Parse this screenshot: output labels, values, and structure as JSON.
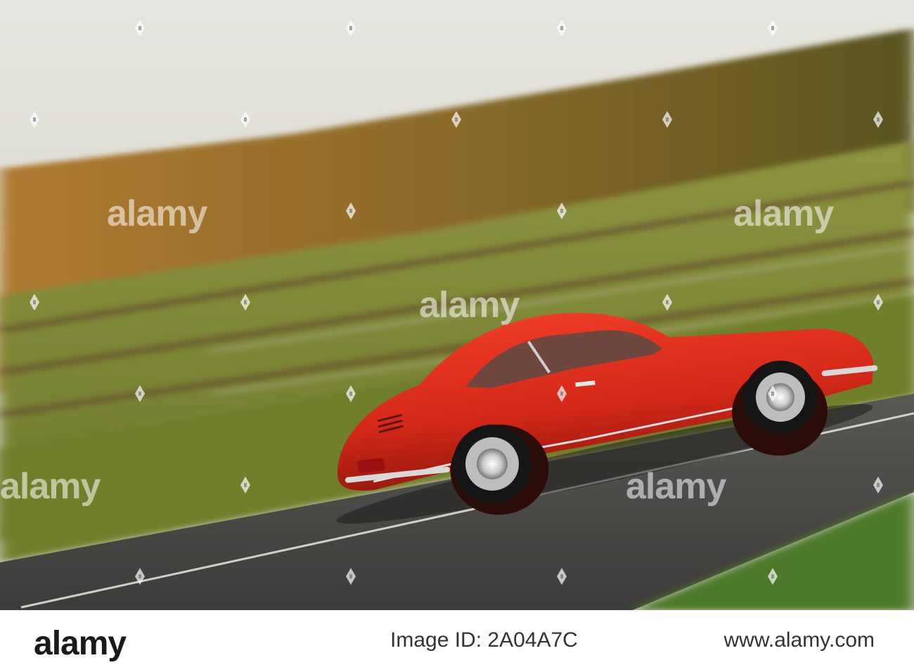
{
  "photo": {
    "subject": "red classic coupe driving on a road",
    "colors": {
      "sky": "#dcdcd4",
      "car": "#d8281c",
      "field": "#7f8a3a",
      "road": "#4d4b48",
      "trees": "#8a5e24"
    }
  },
  "watermark": {
    "text": "alamy"
  },
  "footer": {
    "logo": "alamy",
    "image_id_label": "Image ID: 2A04A7C",
    "url": "www.alamy.com"
  }
}
